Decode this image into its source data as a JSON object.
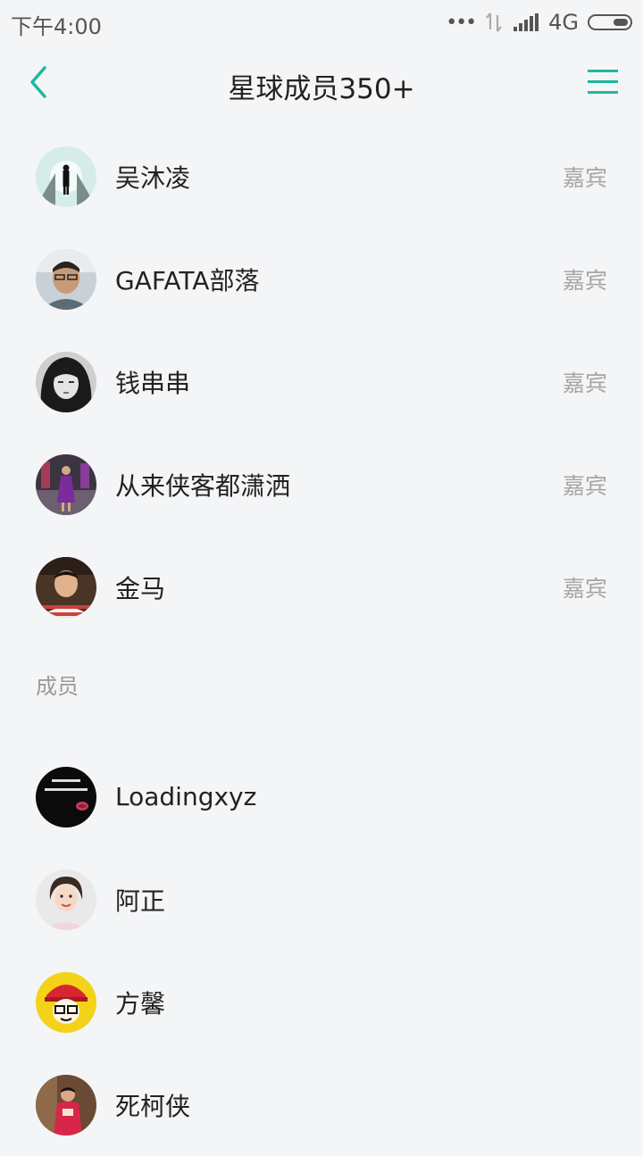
{
  "status_bar": {
    "time": "下午4:00",
    "network": "4G",
    "dots": "•••"
  },
  "header": {
    "title": "星球成员350+"
  },
  "guests": [
    {
      "name": "吴沐凌",
      "role": "嘉宾"
    },
    {
      "name": "GAFATA部落",
      "role": "嘉宾"
    },
    {
      "name": "钱串串",
      "role": "嘉宾"
    },
    {
      "name": "从来侠客都潇洒",
      "role": "嘉宾"
    },
    {
      "name": "金马",
      "role": "嘉宾"
    }
  ],
  "members_section": {
    "label": "成员"
  },
  "members": [
    {
      "name": "Loadingxyz"
    },
    {
      "name": "阿正"
    },
    {
      "name": "方馨"
    },
    {
      "name": "死柯侠"
    }
  ],
  "colors": {
    "accent": "#1fb89a",
    "background": "#f4f5f7",
    "role_text": "#a6a6a6"
  },
  "icons": {
    "back": "chevron-left-icon",
    "menu": "hamburger-menu-icon"
  }
}
